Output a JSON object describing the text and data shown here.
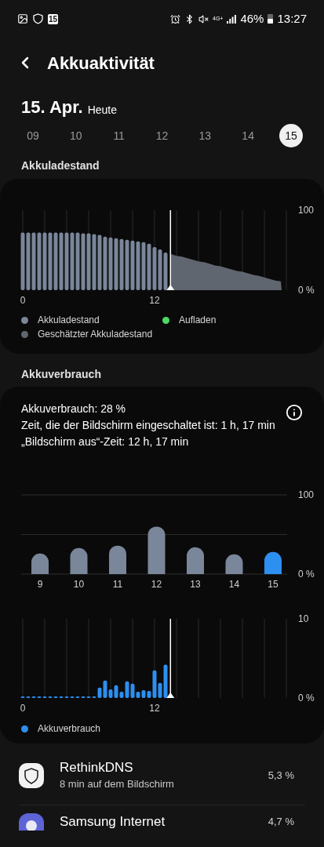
{
  "status_bar": {
    "notification_badge": "15",
    "network": "4G+",
    "battery": "46%",
    "time": "13:27"
  },
  "header": {
    "title": "Akkuaktivität"
  },
  "date": {
    "day": "15. Apr.",
    "label": "Heute"
  },
  "days": [
    {
      "label": "09",
      "selected": false
    },
    {
      "label": "10",
      "selected": false
    },
    {
      "label": "11",
      "selected": false
    },
    {
      "label": "12",
      "selected": false
    },
    {
      "label": "13",
      "selected": false
    },
    {
      "label": "14",
      "selected": false
    },
    {
      "label": "15",
      "selected": true
    }
  ],
  "battery_level": {
    "heading": "Akkuladestand",
    "chart_data": {
      "type": "bar",
      "ylim": [
        0,
        100
      ],
      "xlim": [
        0,
        24
      ],
      "yticks": [
        {
          "value": 100,
          "label": "100"
        },
        {
          "value": 0,
          "label": "0 %"
        }
      ],
      "xticks": [
        {
          "value": 0,
          "label": "0"
        },
        {
          "value": 12,
          "label": "12"
        }
      ],
      "x": [
        0,
        0.5,
        1,
        1.5,
        2,
        2.5,
        3,
        3.5,
        4,
        4.5,
        5,
        5.5,
        6,
        6.5,
        7,
        7.5,
        8,
        8.5,
        9,
        9.5,
        10,
        10.5,
        11,
        11.5,
        12,
        12.5,
        13,
        13.5,
        14,
        14.5,
        15,
        15.5,
        16,
        16.5,
        17,
        17.5,
        18,
        18.5,
        19,
        19.5,
        20,
        20.5,
        21,
        21.5,
        22,
        22.5,
        23,
        23.5
      ],
      "series": [
        {
          "name": "Akkuladestand",
          "type": "bar",
          "color": "#7a8699",
          "values": [
            72,
            72,
            72,
            72,
            72,
            72,
            72,
            72,
            72,
            72,
            72,
            71,
            71,
            70,
            69,
            67,
            66,
            65,
            64,
            63,
            62,
            61,
            60,
            58,
            54,
            51,
            47,
            null,
            null,
            null,
            null,
            null,
            null,
            null,
            null,
            null,
            null,
            null,
            null,
            null,
            null,
            null,
            null,
            null,
            null,
            null,
            null,
            null
          ]
        },
        {
          "name": "Geschätzter Akkuladestand",
          "type": "area",
          "color": "#5f6670",
          "values": [
            null,
            null,
            null,
            null,
            null,
            null,
            null,
            null,
            null,
            null,
            null,
            null,
            null,
            null,
            null,
            null,
            null,
            null,
            null,
            null,
            null,
            null,
            null,
            null,
            null,
            null,
            null,
            45,
            43,
            42,
            40,
            38,
            36,
            35,
            33,
            31,
            30,
            28,
            26,
            24,
            23,
            21,
            19,
            18,
            16,
            14,
            12,
            11
          ]
        }
      ],
      "ref_lines": [
        {
          "value": 13.45,
          "axis": "x"
        }
      ]
    },
    "legend_extra": [
      {
        "label": "Aufladen",
        "color": "#4cd964"
      }
    ]
  },
  "battery_usage": {
    "heading": "Akkuverbrauch",
    "summary": [
      "Akkuverbrauch: 28 %",
      "Zeit, die der Bildschirm eingeschaltet ist: 1 h, 17 min",
      "„Bildschirm aus“-Zeit: 12 h, 17 min"
    ],
    "daily": {
      "chart_data": {
        "type": "bar",
        "ylim": [
          0,
          100
        ],
        "yticks": [
          {
            "value": 100,
            "label": "100"
          },
          {
            "value": 0,
            "label": "0 %"
          }
        ],
        "categories": [
          "9",
          "10",
          "11",
          "12",
          "13",
          "14",
          "15"
        ],
        "series": [
          {
            "color": "#7a8699",
            "values": [
              26,
              33,
              36,
              60,
              34,
              25,
              null
            ]
          },
          {
            "color": "#2d8ff0",
            "values": [
              null,
              null,
              null,
              null,
              null,
              null,
              28
            ]
          }
        ],
        "ref_lines": [
          {
            "value": 50,
            "axis": "y"
          }
        ]
      }
    },
    "hourly": {
      "chart_data": {
        "type": "bar",
        "ylim": [
          0,
          10
        ],
        "xlim": [
          0,
          24
        ],
        "yticks": [
          {
            "value": 10,
            "label": "10"
          },
          {
            "value": 0,
            "label": "0 %"
          }
        ],
        "xticks": [
          {
            "value": 0,
            "label": "0"
          },
          {
            "value": 12,
            "label": "12"
          }
        ],
        "x": [
          0,
          0.5,
          1,
          1.5,
          2,
          2.5,
          3,
          3.5,
          4,
          4.5,
          5,
          5.5,
          6,
          6.5,
          7,
          7.5,
          8,
          8.5,
          9,
          9.5,
          10,
          10.5,
          11,
          11.5,
          12,
          12.5,
          13
        ],
        "series": [
          {
            "name": "Akkuverbrauch",
            "type": "bar",
            "color": "#2d8ff0",
            "values": [
              0.1,
              0.1,
              0.1,
              0.1,
              0.1,
              0.1,
              0.1,
              0.1,
              0.2,
              0.1,
              0.1,
              0.1,
              0.1,
              0.1,
              1.3,
              2.2,
              1.1,
              1.6,
              0.8,
              2.1,
              1.8,
              0.8,
              1.0,
              0.9,
              3.5,
              1.9,
              4.2
            ]
          }
        ],
        "ref_lines": [
          {
            "value": 13.45,
            "axis": "x"
          }
        ]
      }
    }
  },
  "apps": [
    {
      "kind": "shield",
      "name": "RethinkDNS",
      "detail": "8 min auf dem Bildschirm",
      "percent": "5,3 %"
    },
    {
      "kind": "planet",
      "name": "Samsung Internet",
      "percent": "4,7 %"
    }
  ]
}
